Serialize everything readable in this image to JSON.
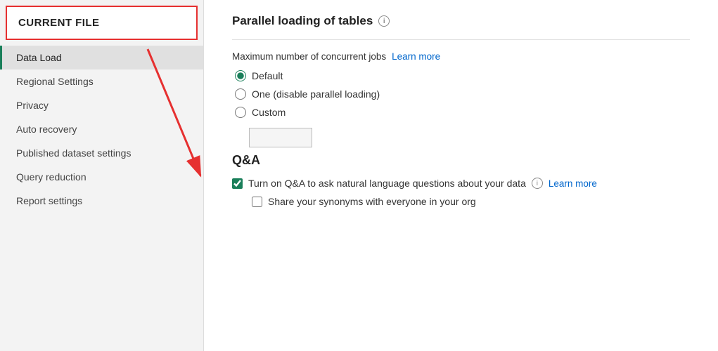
{
  "sidebar": {
    "header": "CURRENT FILE",
    "items": [
      {
        "id": "data-load",
        "label": "Data Load",
        "active": true
      },
      {
        "id": "regional-settings",
        "label": "Regional Settings",
        "active": false
      },
      {
        "id": "privacy",
        "label": "Privacy",
        "active": false
      },
      {
        "id": "auto-recovery",
        "label": "Auto recovery",
        "active": false
      },
      {
        "id": "published-dataset-settings",
        "label": "Published dataset settings",
        "active": false
      },
      {
        "id": "query-reduction",
        "label": "Query reduction",
        "active": false
      },
      {
        "id": "report-settings",
        "label": "Report settings",
        "active": false
      }
    ]
  },
  "main": {
    "parallel_loading": {
      "title": "Parallel loading of tables",
      "max_jobs_label": "Maximum number of concurrent jobs",
      "learn_more": "Learn more",
      "options": [
        {
          "id": "default",
          "label": "Default",
          "checked": true
        },
        {
          "id": "one",
          "label": "One (disable parallel loading)",
          "checked": false
        },
        {
          "id": "custom",
          "label": "Custom",
          "checked": false
        }
      ],
      "custom_placeholder": ""
    },
    "qa": {
      "title": "Q&A",
      "turn_on_label": "Turn on Q&A to ask natural language questions about your data",
      "turn_on_checked": true,
      "learn_more": "Learn more",
      "share_synonyms_label": "Share your synonyms with everyone in your org",
      "share_synonyms_checked": false
    }
  }
}
